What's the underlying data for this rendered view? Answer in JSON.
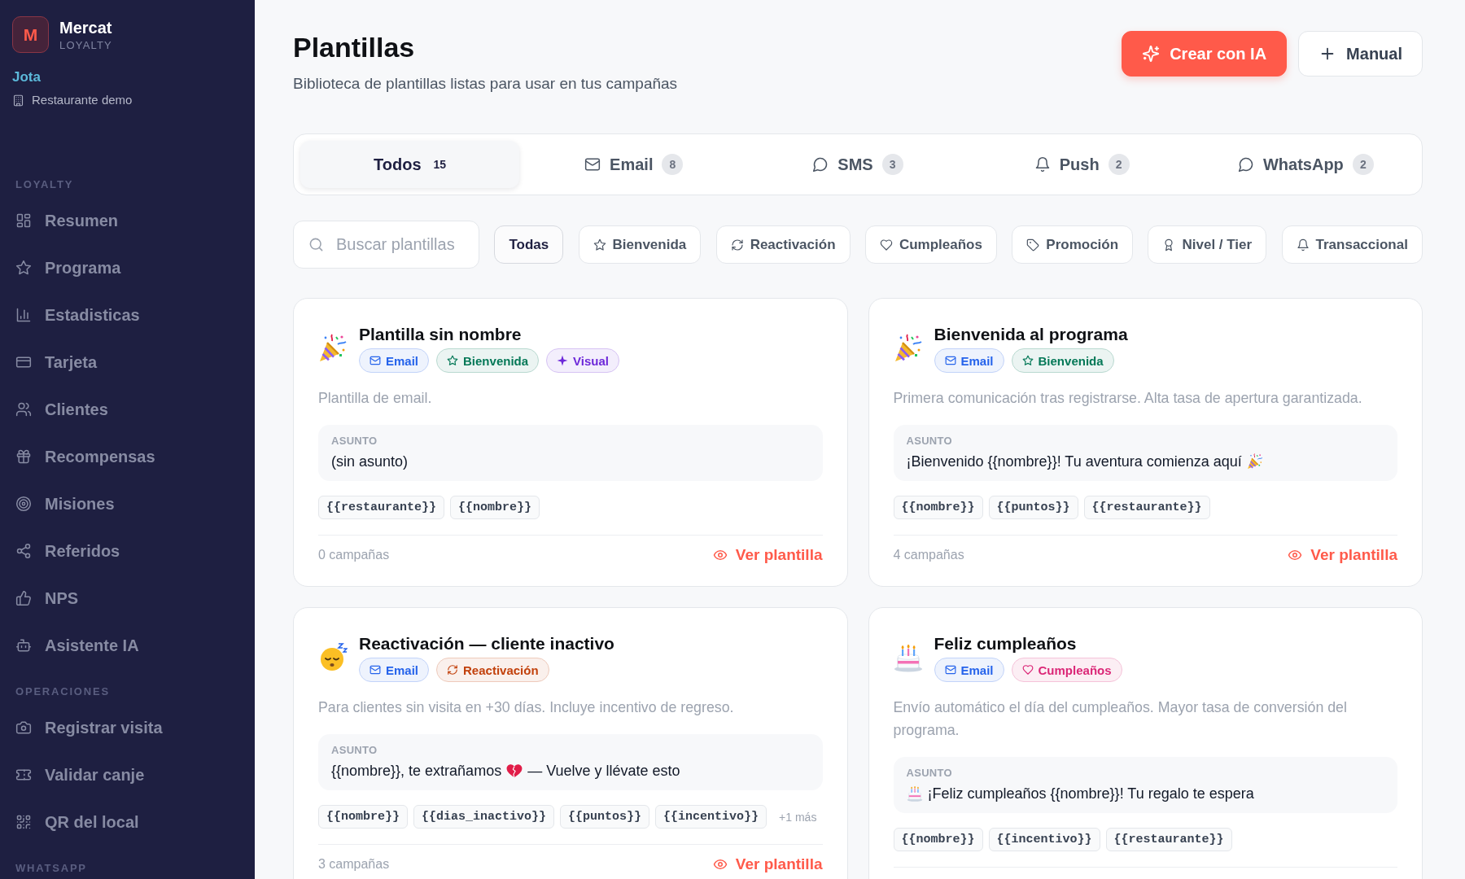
{
  "sidebar": {
    "brand": {
      "initial": "M",
      "name": "Mercat",
      "tagline": "LOYALTY"
    },
    "user": {
      "name": "Jota",
      "venue": "Restaurante demo"
    },
    "sections": [
      {
        "title": "LOYALTY",
        "items": [
          {
            "label": "Resumen",
            "kind": "summary",
            "selected": false
          },
          {
            "label": "Programa",
            "kind": "program",
            "selected": false
          },
          {
            "label": "Estadisticas",
            "kind": "stats",
            "selected": false
          },
          {
            "label": "Tarjeta",
            "kind": "card",
            "selected": false
          },
          {
            "label": "Clientes",
            "kind": "clients",
            "selected": false
          },
          {
            "label": "Recompensas",
            "kind": "rewards",
            "selected": false
          },
          {
            "label": "Misiones",
            "kind": "missions",
            "selected": false
          },
          {
            "label": "Referidos",
            "kind": "referrals",
            "selected": false
          },
          {
            "label": "NPS",
            "kind": "nps",
            "selected": false
          },
          {
            "label": "Asistente IA",
            "kind": "assistant",
            "selected": false
          }
        ]
      },
      {
        "title": "OPERACIONES",
        "items": [
          {
            "label": "Registrar visita",
            "kind": "visit",
            "selected": false
          },
          {
            "label": "Validar canje",
            "kind": "redeem",
            "selected": false
          },
          {
            "label": "QR del local",
            "kind": "qr",
            "selected": false
          }
        ]
      },
      {
        "title": "WHATSAPP"
      }
    ]
  },
  "header": {
    "title": "Plantillas",
    "subtitle": "Biblioteca de plantillas listas para usar en tus campañas",
    "actions": [
      {
        "label": "Crear con IA",
        "kind": "primary"
      },
      {
        "label": "Manual",
        "kind": "secondary"
      }
    ]
  },
  "channel_tabs": [
    {
      "label": "Todos",
      "count": "15",
      "kind": "all",
      "selected": true
    },
    {
      "label": "Email",
      "count": "8",
      "kind": "email",
      "selected": false
    },
    {
      "label": "SMS",
      "count": "3",
      "kind": "sms",
      "selected": false
    },
    {
      "label": "Push",
      "count": "2",
      "kind": "push",
      "selected": false
    },
    {
      "label": "WhatsApp",
      "count": "2",
      "kind": "whatsapp",
      "selected": false
    }
  ],
  "search": {
    "placeholder": "Buscar plantillas"
  },
  "filters": [
    {
      "label": "Todas",
      "kind": "all",
      "selected": true
    },
    {
      "label": "Bienvenida",
      "kind": "welcome",
      "selected": false
    },
    {
      "label": "Reactivación",
      "kind": "reactivation",
      "selected": false
    },
    {
      "label": "Cumpleaños",
      "kind": "birthday",
      "selected": false
    },
    {
      "label": "Promoción",
      "kind": "promotion",
      "selected": false
    },
    {
      "label": "Nivel / Tier",
      "kind": "tier",
      "selected": false
    },
    {
      "label": "Transaccional",
      "kind": "transactional",
      "selected": false
    }
  ],
  "templates": [
    {
      "kind": "party",
      "title": "Plantilla sin nombre",
      "tags": [
        {
          "label": "Email",
          "kind": "email",
          "color": "#2563eb"
        },
        {
          "label": "Bienvenida",
          "kind": "welcome",
          "color": "#047857"
        },
        {
          "label": "Visual",
          "kind": "visual",
          "color": "#6d28d9"
        }
      ],
      "description": "Plantilla de email.",
      "subject_label": "ASUNTO",
      "subject": [
        {
          "kind": "text",
          "text": "(sin asunto)"
        }
      ],
      "variables": [
        "{{restaurante}}",
        "{{nombre}}"
      ],
      "campaigns": "0 campañas",
      "action": "Ver plantilla"
    },
    {
      "kind": "party",
      "title": "Bienvenida al programa",
      "tags": [
        {
          "label": "Email",
          "kind": "email",
          "color": "#2563eb"
        },
        {
          "label": "Bienvenida",
          "kind": "welcome",
          "color": "#047857"
        }
      ],
      "description": "Primera comunicación tras registrarse. Alta tasa de apertura garantizada.",
      "subject_label": "ASUNTO",
      "subject": [
        {
          "kind": "text",
          "text": "¡Bienvenido {{nombre}}! Tu aventura comienza aquí"
        },
        {
          "kind": "party"
        }
      ],
      "variables": [
        "{{nombre}}",
        "{{puntos}}",
        "{{restaurante}}"
      ],
      "campaigns": "4 campañas",
      "action": "Ver plantilla"
    },
    {
      "kind": "sleepy",
      "title": "Reactivación — cliente inactivo",
      "tags": [
        {
          "label": "Email",
          "kind": "email",
          "color": "#2563eb"
        },
        {
          "label": "Reactivación",
          "kind": "reactivation",
          "color": "#c2410c"
        }
      ],
      "description": "Para clientes sin visita en +30 días. Incluye incentivo de regreso.",
      "subject_label": "ASUNTO",
      "subject": [
        {
          "kind": "text",
          "text": "{{nombre}}, te extrañamos"
        },
        {
          "kind": "heartbreak"
        },
        {
          "kind": "text",
          "text": "— Vuelve y llévate esto"
        }
      ],
      "variables": [
        "{{nombre}}",
        "{{dias_inactivo}}",
        "{{puntos}}",
        "{{incentivo}}"
      ],
      "more": "+1 más",
      "campaigns": "3 campañas",
      "action": "Ver plantilla"
    },
    {
      "kind": "cake",
      "title": "Feliz cumpleaños",
      "tags": [
        {
          "label": "Email",
          "kind": "email",
          "color": "#2563eb"
        },
        {
          "label": "Cumpleaños",
          "kind": "birthday",
          "color": "#db2777"
        }
      ],
      "description": "Envío automático el día del cumpleaños. Mayor tasa de conversión del programa.",
      "subject_label": "ASUNTO",
      "subject": [
        {
          "kind": "cake"
        },
        {
          "kind": "text",
          "text": "¡Feliz cumpleaños {{nombre}}! Tu regalo te espera"
        }
      ],
      "variables": [
        "{{nombre}}",
        "{{incentivo}}",
        "{{restaurante}}"
      ]
    }
  ]
}
